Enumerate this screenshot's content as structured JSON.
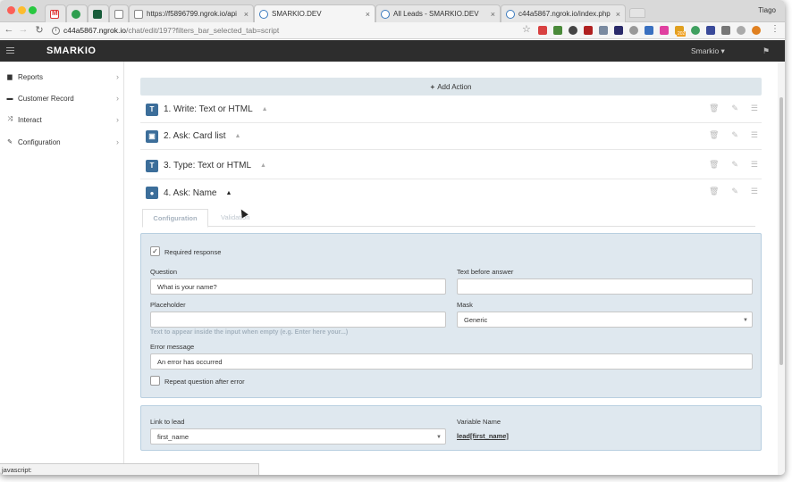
{
  "browser": {
    "tabs": [
      {
        "title": "",
        "icon": "gmail-icon"
      },
      {
        "title": "",
        "icon": "whatsapp-icon"
      },
      {
        "title": "",
        "icon": "app-icon"
      },
      {
        "title": "https://f5896799.ngrok.io/api",
        "icon": "document-icon"
      },
      {
        "title": "SMARKIO.DEV",
        "icon": "smarkio-icon"
      },
      {
        "title": "All Leads - SMARKIO.DEV",
        "icon": "smarkio-icon"
      },
      {
        "title": "c44a5867.ngrok.io/index.php",
        "icon": "smarkio-icon"
      }
    ],
    "close_glyph": "×",
    "user": "Tiago",
    "url_host": "c44a5867.ngrok.io",
    "url_path": "/chat/edit/197?filters_bar_selected_tab=script",
    "status_text": "javascript:",
    "extension_badge": "202"
  },
  "app": {
    "logo": "SMARKIO",
    "account_label": "Smarkio ▾"
  },
  "sidebar": {
    "items": [
      {
        "label": "Reports",
        "icon": "bar-chart-icon"
      },
      {
        "label": "Customer Record",
        "icon": "address-card-icon"
      },
      {
        "label": "Interact",
        "icon": "shuffle-icon"
      },
      {
        "label": "Configuration",
        "icon": "wrench-icon"
      }
    ]
  },
  "actions": {
    "add_label": "Add Action",
    "items": [
      {
        "badge": "T",
        "title": "1. Write: Text or HTML"
      },
      {
        "badge": "▣",
        "title": "2. Ask: Card list"
      },
      {
        "badge": "T",
        "title": "3. Type: Text or HTML"
      },
      {
        "badge": "●",
        "title": "4. Ask: Name"
      }
    ]
  },
  "editor": {
    "tabs": [
      "Configuration",
      "Validation"
    ],
    "required_label": "Required response",
    "required_checked": true,
    "question_label": "Question",
    "question_value": "What is your name?",
    "text_before_label": "Text before answer",
    "text_before_value": "",
    "placeholder_label": "Placeholder",
    "placeholder_value": "",
    "placeholder_hint": "Text to appear inside the input when empty (e.g. Enter here your...)",
    "mask_label": "Mask",
    "mask_value": "Generic",
    "error_label": "Error message",
    "error_value": "An error has occurred",
    "repeat_label": "Repeat question after error",
    "repeat_checked": false,
    "link_label": "Link to lead",
    "link_value": "first_name",
    "variable_label": "Variable Name",
    "variable_value": "lead[first_name]"
  }
}
